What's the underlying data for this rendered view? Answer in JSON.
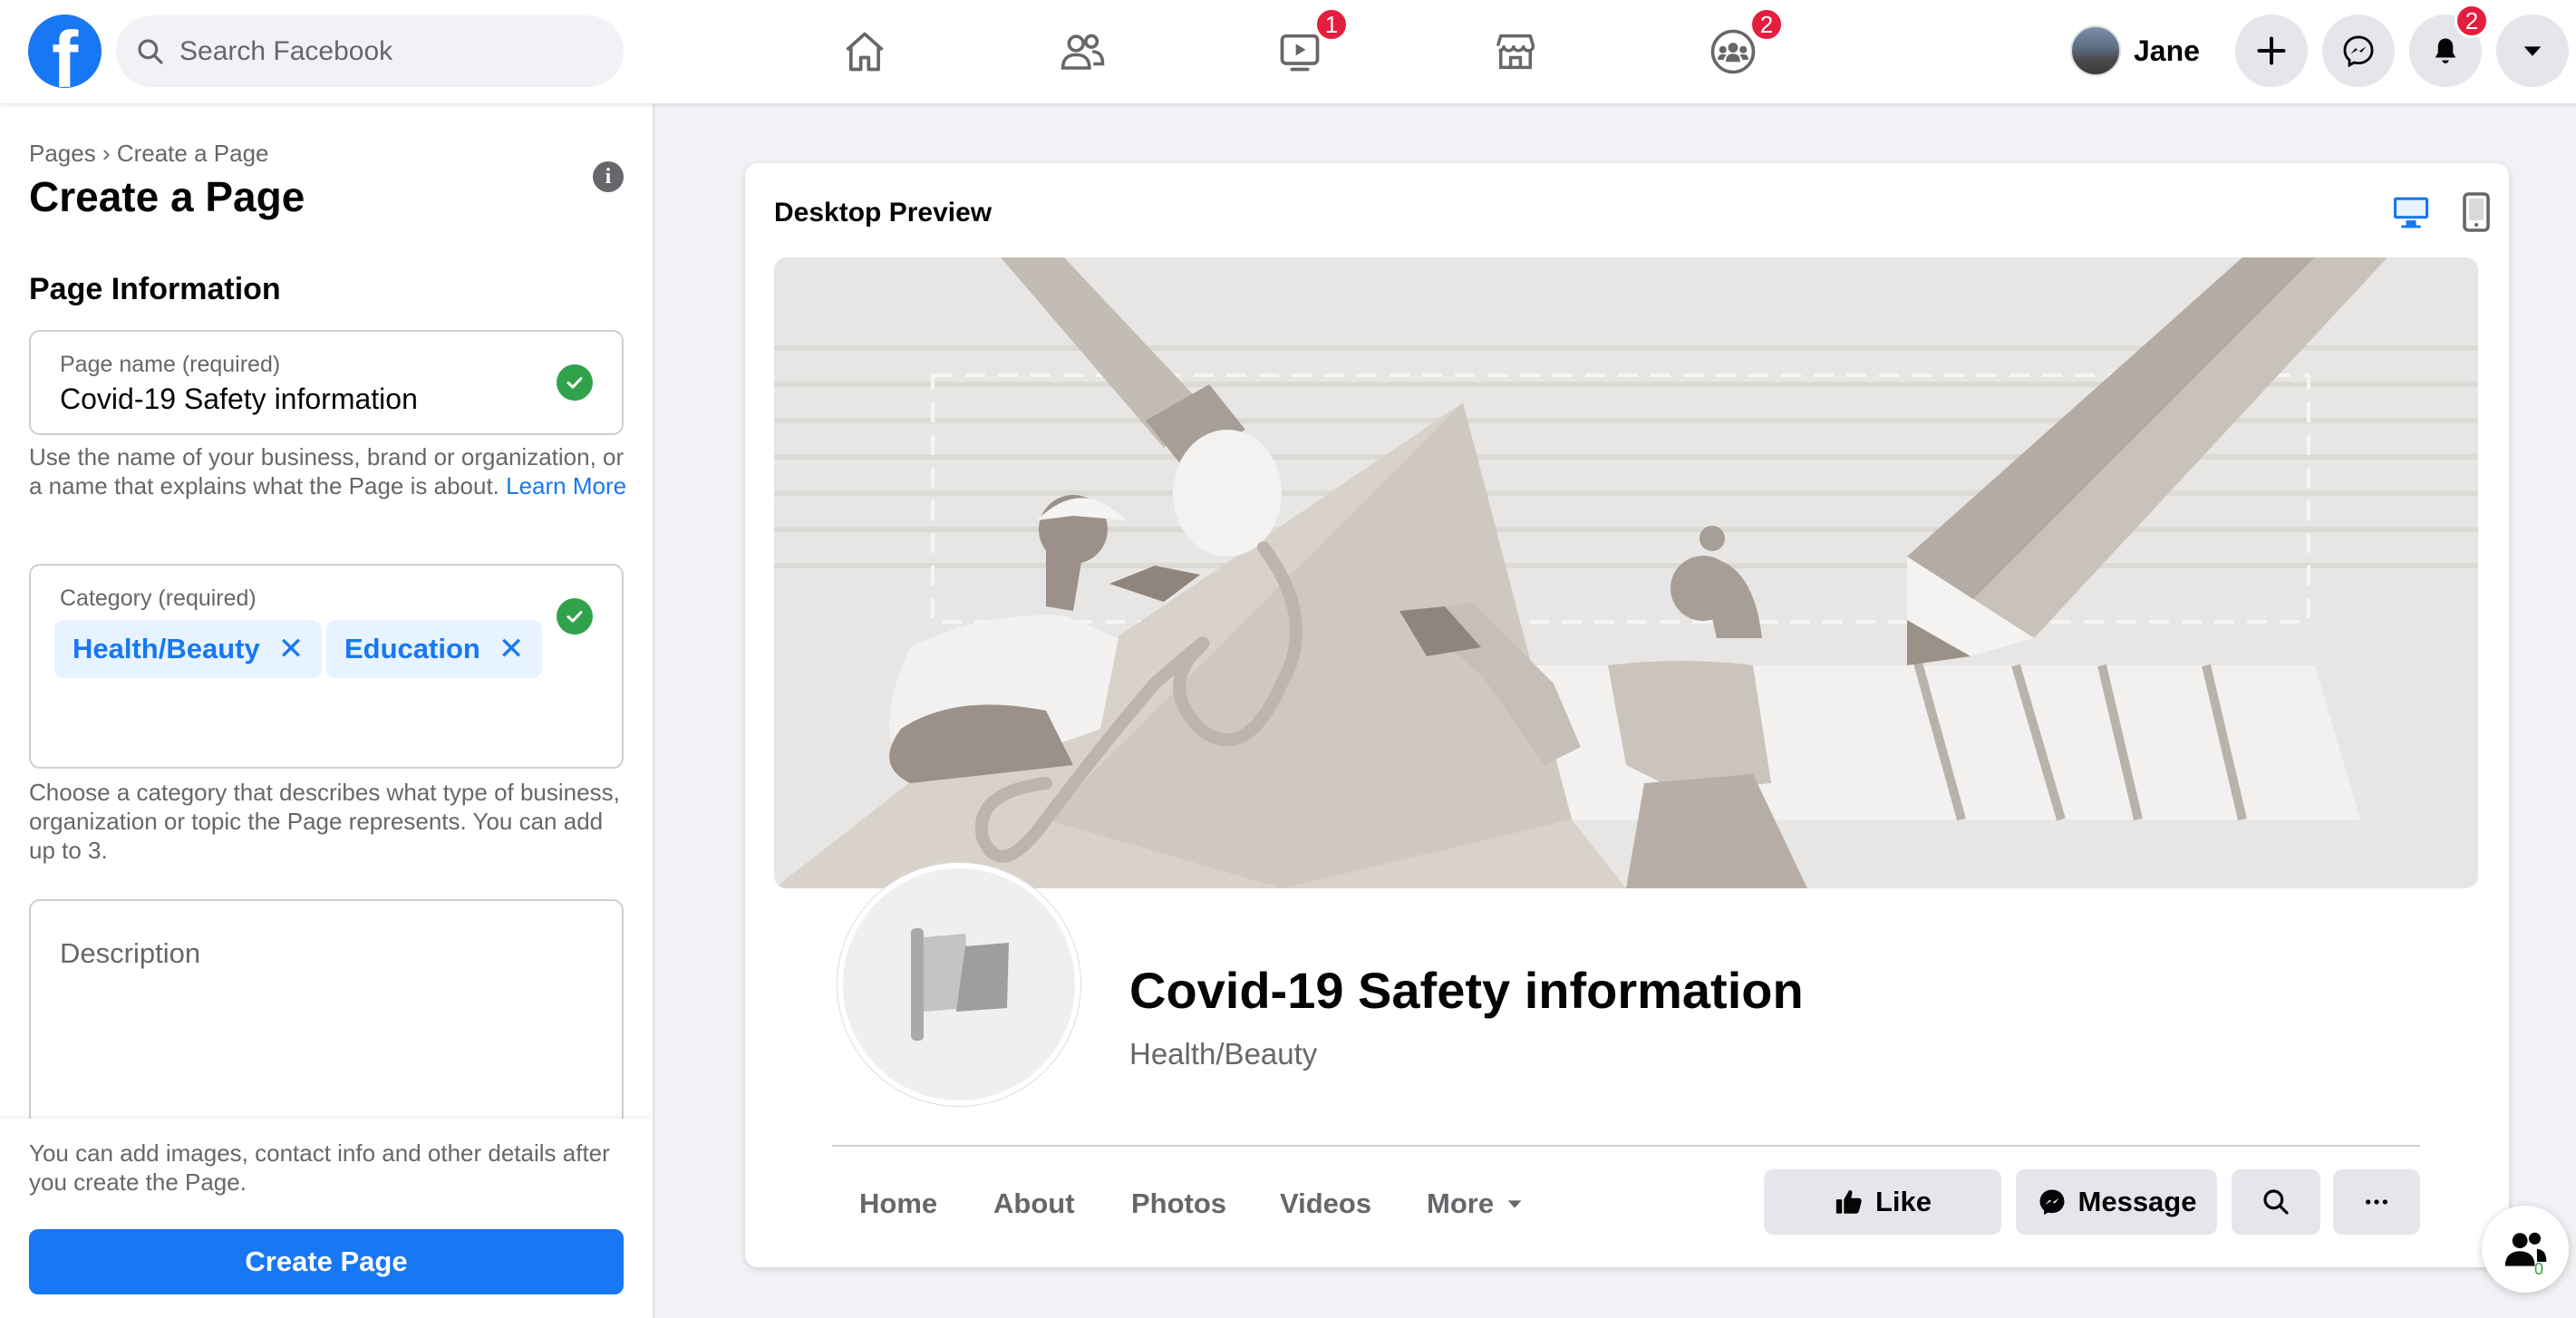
{
  "topbar": {
    "logo_letter": "f",
    "search_placeholder": "Search Facebook",
    "nav": [
      {
        "name": "home",
        "badge": ""
      },
      {
        "name": "friends",
        "badge": ""
      },
      {
        "name": "watch",
        "badge": "1"
      },
      {
        "name": "marketplace",
        "badge": ""
      },
      {
        "name": "groups",
        "badge": "2"
      }
    ],
    "profile_name": "Jane",
    "notifications_badge": "2"
  },
  "left_panel": {
    "breadcrumb": "Pages › Create a Page",
    "title": "Create a Page",
    "info_icon": "i",
    "section_title": "Page Information",
    "page_name": {
      "label": "Page name (required)",
      "value": "Covid-19 Safety information",
      "help": "Use the name of your business, brand or organization, or a name that explains what the Page is about.",
      "help_link": "Learn More"
    },
    "category": {
      "label": "Category (required)",
      "chips": [
        "Health/Beauty",
        "Education"
      ],
      "chip_remove": "✕",
      "help": "Choose a category that describes what type of business, organization or topic the Page represents. You can add up to 3."
    },
    "description": {
      "placeholder": "Description"
    },
    "footer_note": "You can add images, contact info and other details after you create the Page.",
    "create_button": "Create Page"
  },
  "preview": {
    "title": "Desktop Preview",
    "page_name": "Covid-19 Safety information",
    "category": "Health/Beauty",
    "tabs": [
      "Home",
      "About",
      "Photos",
      "Videos",
      "More"
    ],
    "buttons": {
      "like": "Like",
      "message": "Message"
    },
    "contacts_count": "0",
    "colors": {
      "accent": "#1877f2",
      "badge": "#e41e3f",
      "check": "#31a24c"
    }
  }
}
